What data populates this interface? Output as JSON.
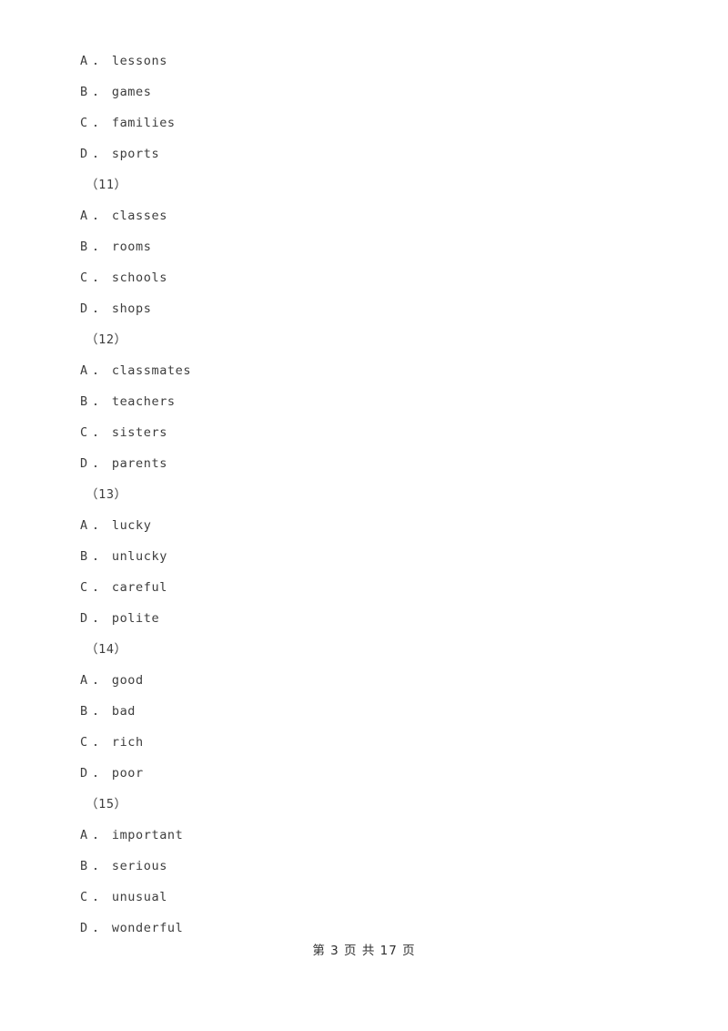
{
  "document": {
    "background_color": "#ffffff",
    "text_color": "#3d3d3d"
  },
  "blocks": [
    {
      "question_number": null,
      "options": [
        {
          "letter": "A",
          "dot": "．",
          "text": "lessons"
        },
        {
          "letter": "B",
          "dot": "．",
          "text": "games"
        },
        {
          "letter": "C",
          "dot": "．",
          "text": "families"
        },
        {
          "letter": "D",
          "dot": "．",
          "text": "sports"
        }
      ]
    },
    {
      "question_number": "（11）",
      "options": [
        {
          "letter": "A",
          "dot": "．",
          "text": "classes"
        },
        {
          "letter": "B",
          "dot": "．",
          "text": "rooms"
        },
        {
          "letter": "C",
          "dot": "．",
          "text": "schools"
        },
        {
          "letter": "D",
          "dot": "．",
          "text": "shops"
        }
      ]
    },
    {
      "question_number": "（12）",
      "options": [
        {
          "letter": "A",
          "dot": "．",
          "text": "classmates"
        },
        {
          "letter": "B",
          "dot": "．",
          "text": "teachers"
        },
        {
          "letter": "C",
          "dot": "．",
          "text": "sisters"
        },
        {
          "letter": "D",
          "dot": "．",
          "text": "parents"
        }
      ]
    },
    {
      "question_number": "（13）",
      "options": [
        {
          "letter": "A",
          "dot": "．",
          "text": "lucky"
        },
        {
          "letter": "B",
          "dot": "．",
          "text": "unlucky"
        },
        {
          "letter": "C",
          "dot": "．",
          "text": "careful"
        },
        {
          "letter": "D",
          "dot": "．",
          "text": "polite"
        }
      ]
    },
    {
      "question_number": "（14）",
      "options": [
        {
          "letter": "A",
          "dot": "．",
          "text": "good"
        },
        {
          "letter": "B",
          "dot": "．",
          "text": "bad"
        },
        {
          "letter": "C",
          "dot": "．",
          "text": "rich"
        },
        {
          "letter": "D",
          "dot": "．",
          "text": "poor"
        }
      ]
    },
    {
      "question_number": "（15）",
      "options": [
        {
          "letter": "A",
          "dot": "．",
          "text": "important"
        },
        {
          "letter": "B",
          "dot": "．",
          "text": "serious"
        },
        {
          "letter": "C",
          "dot": "．",
          "text": "unusual"
        },
        {
          "letter": "D",
          "dot": "．",
          "text": "wonderful"
        }
      ]
    }
  ],
  "footer": {
    "text": "第 3 页 共 17 页",
    "current_page": "3",
    "total_pages": "17"
  }
}
